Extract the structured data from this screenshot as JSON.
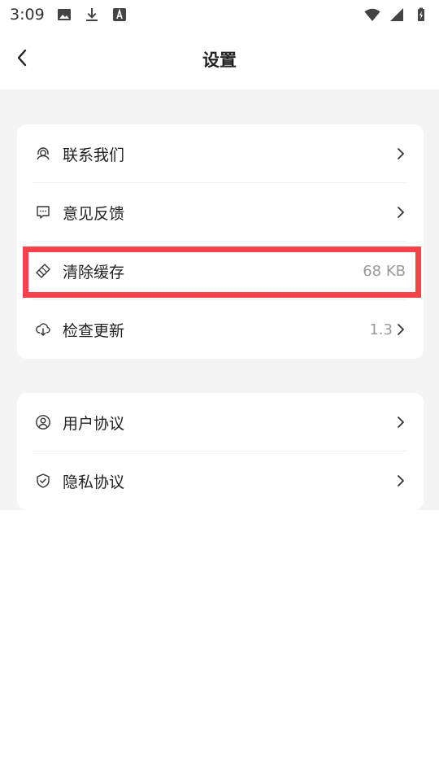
{
  "status_bar": {
    "time": "3:09",
    "icons_left": [
      "image-icon",
      "download-icon",
      "a-box-icon"
    ],
    "icons_right": [
      "wifi-icon",
      "signal-icon",
      "battery-charging-icon"
    ]
  },
  "header": {
    "title": "设置",
    "back_icon": "chevron-left-icon"
  },
  "settings": {
    "group1": [
      {
        "label": "联系我们",
        "icon": "headset-icon",
        "value": "",
        "chevron": true
      },
      {
        "label": "意见反馈",
        "icon": "feedback-icon",
        "value": "",
        "chevron": true
      },
      {
        "label": "清除缓存",
        "icon": "broom-icon",
        "value": "68 KB",
        "chevron": false,
        "highlighted": true
      },
      {
        "label": "检查更新",
        "icon": "cloud-download-icon",
        "value": "1.3",
        "chevron": true
      }
    ],
    "group2": [
      {
        "label": "用户协议",
        "icon": "user-circle-icon",
        "value": "",
        "chevron": true
      },
      {
        "label": "隐私协议",
        "icon": "shield-check-icon",
        "value": "",
        "chevron": true
      }
    ]
  },
  "colors": {
    "highlight_border": "#f8424b",
    "background_gray": "#f4f4f4",
    "value_text": "#9a9a9a"
  }
}
